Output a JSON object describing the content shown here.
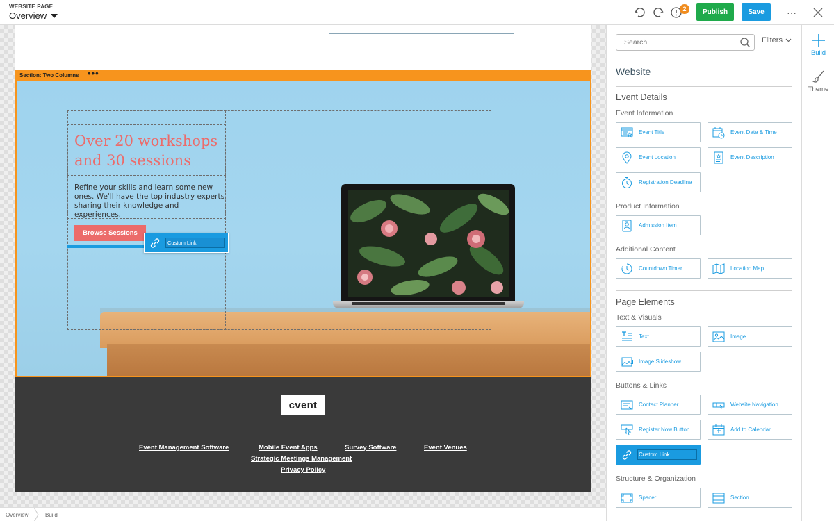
{
  "topbar": {
    "small_label": "WEBSITE PAGE",
    "page_select": "Overview",
    "alert_count": "2",
    "publish_label": "Publish",
    "save_label": "Save",
    "more_label": "···"
  },
  "canvas": {
    "section_label": "Section: Two Columns",
    "section_menu": "•••",
    "hero": {
      "heading": "Over 20 workshops and 30 sessions",
      "body": "Refine your skills and learn some new ones. We'll have the top industry experts sharing their knowledge and experiences.",
      "button_label": "Browse Sessions",
      "drag_item_label": "Custom Link"
    },
    "footer": {
      "logo_text": "cvent",
      "links": [
        "Event Management Software",
        "Mobile Event Apps",
        "Survey Software",
        "Event Venues",
        "Strategic Meetings Management",
        "Privacy Policy"
      ]
    }
  },
  "breadcrumb": [
    "Overview",
    "Build"
  ],
  "panel": {
    "search_placeholder": "Search",
    "filters_label": "Filters",
    "title": "Website",
    "groups": [
      {
        "title": "Event Details",
        "subgroups": [
          {
            "title": "Event Information",
            "items": [
              "Event Title",
              "Event Date & Time",
              "Event Location",
              "Event Description",
              "Registration Deadline"
            ]
          },
          {
            "title": "Product Information",
            "items": [
              "Admission Item"
            ]
          },
          {
            "title": "Additional Content",
            "items": [
              "Countdown Timer",
              "Location Map"
            ]
          }
        ]
      },
      {
        "title": "Page Elements",
        "subgroups": [
          {
            "title": "Text & Visuals",
            "items": [
              "Text",
              "Image",
              "Image Slideshow"
            ]
          },
          {
            "title": "Buttons & Links",
            "items": [
              "Contact Planner",
              "Website Navigation",
              "Register Now Button",
              "Add to Calendar",
              "Custom Link"
            ]
          },
          {
            "title": "Structure & Organization",
            "items": [
              "Spacer",
              "Section"
            ]
          }
        ]
      }
    ]
  },
  "rail": {
    "build_label": "Build",
    "theme_label": "Theme"
  },
  "colors": {
    "accent": "#1a9be0",
    "publish": "#1faa4b",
    "section_highlight": "#f7941d",
    "hero_text": "#ec6b6a",
    "footer_bg": "#3a3a3a"
  }
}
